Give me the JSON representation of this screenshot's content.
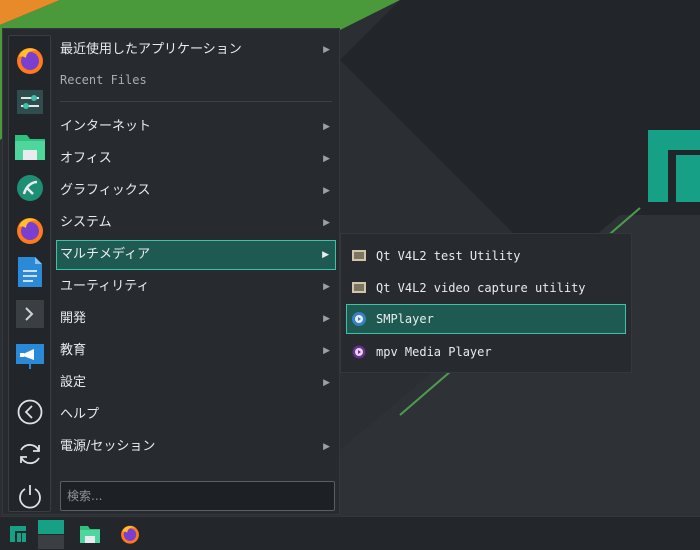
{
  "menu": {
    "recent_apps": "最近使用したアプリケーション",
    "recent_files": "Recent Files",
    "categories": [
      {
        "label": "インターネット"
      },
      {
        "label": "オフィス"
      },
      {
        "label": "グラフィックス"
      },
      {
        "label": "システム"
      },
      {
        "label": "マルチメディア"
      },
      {
        "label": "ユーティリティ"
      },
      {
        "label": "開発"
      },
      {
        "label": "教育"
      },
      {
        "label": "設定"
      },
      {
        "label": "ヘルプ"
      },
      {
        "label": "電源/セッション"
      }
    ],
    "search_placeholder": "検索..."
  },
  "submenu": {
    "items": [
      {
        "label": "Qt V4L2 test Utility"
      },
      {
        "label": "Qt V4L2 video capture utility"
      },
      {
        "label": "SMPlayer"
      },
      {
        "label": "mpv Media Player"
      }
    ]
  },
  "colors": {
    "accent": "#3ec1a9",
    "highlight_bg": "#1f5a52",
    "manjaro_green": "#35bf5c",
    "panel_bg": "#272a2e"
  },
  "icons": {
    "favorites": [
      "firefox-icon",
      "settings-icon",
      "file-manager-icon",
      "app-icon",
      "firefox-icon",
      "document-icon",
      "terminal-icon",
      "presentation-icon"
    ],
    "session": [
      "back-icon",
      "refresh-icon",
      "power-icon"
    ]
  }
}
